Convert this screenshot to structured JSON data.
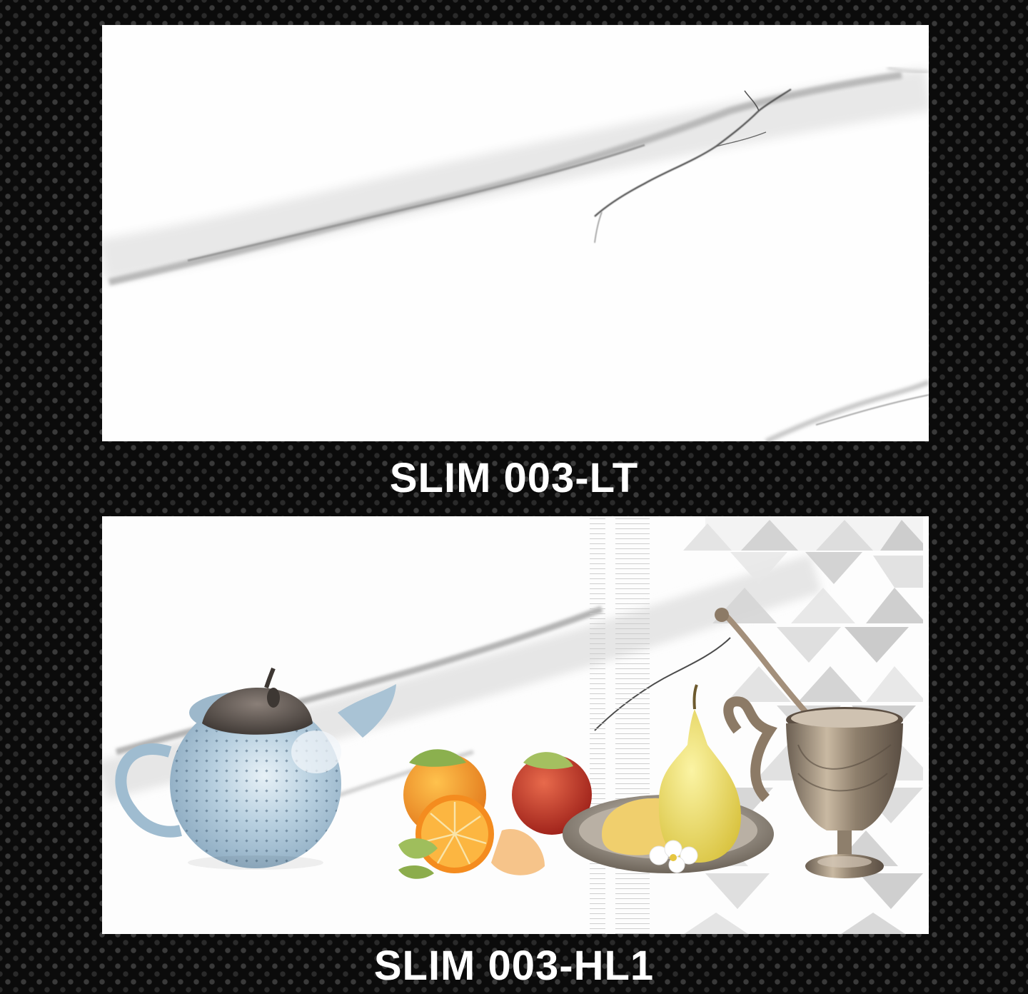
{
  "tiles": [
    {
      "label": "SLIM 003-LT",
      "finish": "white marble with grey veins"
    },
    {
      "label": "SLIM 003-HL1",
      "finish": "white marble with kitchen still-life print"
    }
  ],
  "colors": {
    "background": "#0b0b0b",
    "dot": "#3a3a3a",
    "tile": "#ffffff",
    "vein": "#8f8f8f",
    "caption": "#ffffff"
  },
  "icons": {
    "teapot": "teapot-illustration",
    "fruits": "orange-apple-illustration",
    "plate": "pear-plate-illustration",
    "cup": "brass-goblet-illustration",
    "pattern": "triangle-pattern"
  }
}
